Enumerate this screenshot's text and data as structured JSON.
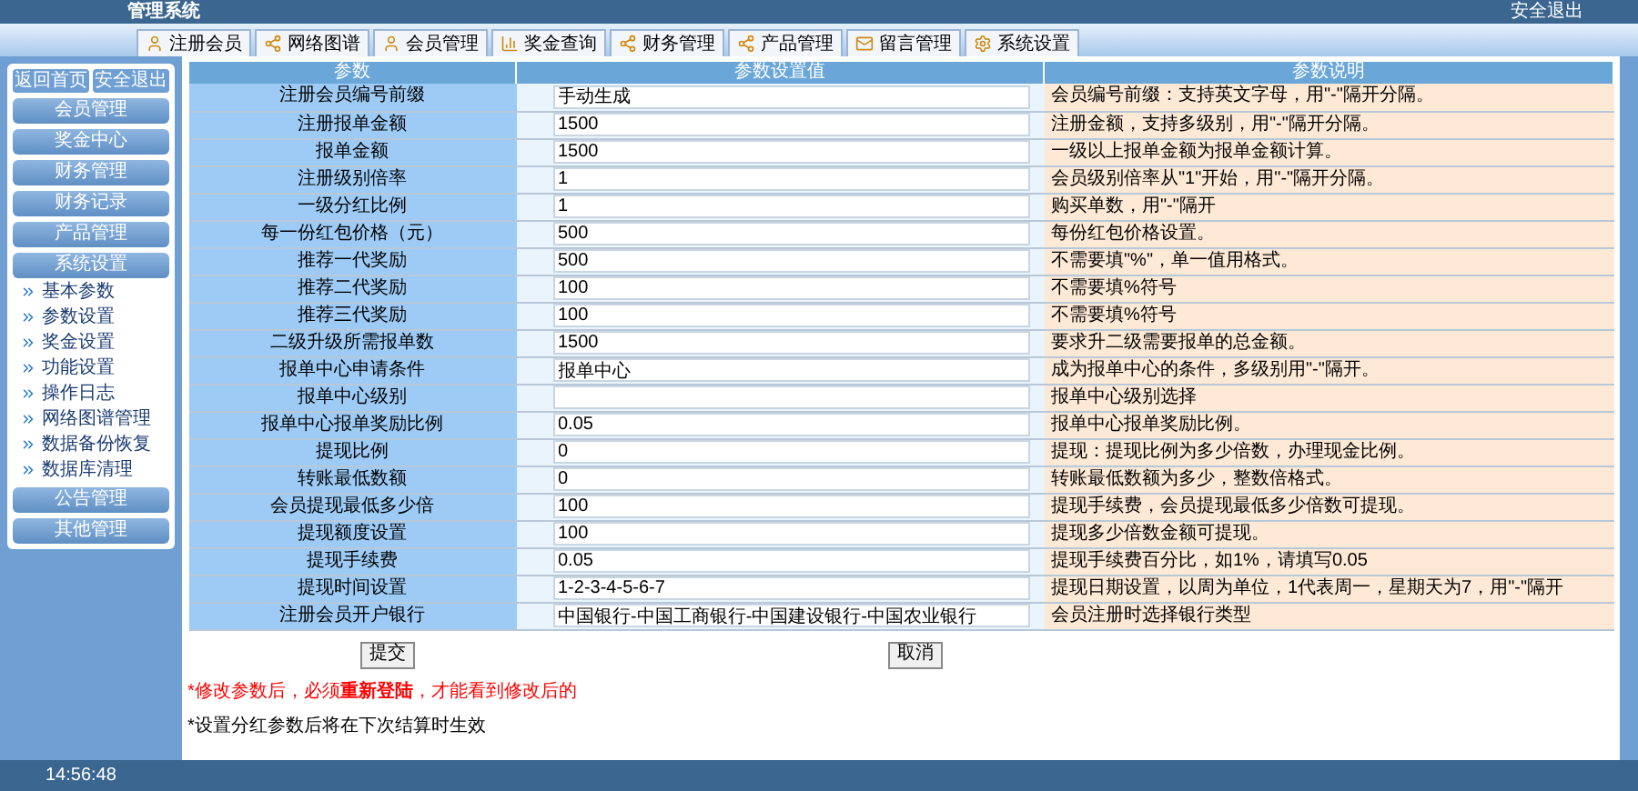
{
  "header": {
    "title": "管理系统",
    "logout": "安全退出"
  },
  "tabs": [
    {
      "label": "注册会员"
    },
    {
      "label": "网络图谱"
    },
    {
      "label": "会员管理"
    },
    {
      "label": "奖金查询"
    },
    {
      "label": "财务管理"
    },
    {
      "label": "产品管理"
    },
    {
      "label": "留言管理"
    },
    {
      "label": "系统设置"
    }
  ],
  "sidebar": {
    "top_buttons": [
      "返回首页",
      "安全退出"
    ],
    "menus": [
      {
        "label": "会员管理"
      },
      {
        "label": "奖金中心"
      },
      {
        "label": "财务管理"
      },
      {
        "label": "财务记录"
      },
      {
        "label": "产品管理"
      },
      {
        "label": "系统设置",
        "children": [
          "基本参数",
          "参数设置",
          "奖金设置",
          "功能设置",
          "操作日志",
          "网络图谱管理",
          "数据备份恢复",
          "数据库清理"
        ]
      },
      {
        "label": "公告管理"
      },
      {
        "label": "其他管理"
      }
    ]
  },
  "table": {
    "columns": [
      "参数",
      "参数设置值",
      "参数说明"
    ],
    "rows": [
      {
        "label": "注册会员编号前缀",
        "value": "手动生成",
        "note": "会员编号前缀：支持英文字母，用\"-\"隔开分隔。"
      },
      {
        "label": "注册报单金额",
        "value": "1500",
        "note": "注册金额，支持多级别，用\"-\"隔开分隔。"
      },
      {
        "label": "报单金额",
        "value": "1500",
        "note": "一级以上报单金额为报单金额计算。"
      },
      {
        "label": "注册级别倍率",
        "value": "1",
        "note": "会员级别倍率从\"1\"开始，用\"-\"隔开分隔。"
      },
      {
        "label": "一级分红比例",
        "value": "1",
        "note": "购买单数，用\"-\"隔开"
      },
      {
        "label": "每一份红包价格（元）",
        "value": "500",
        "note": "每份红包价格设置。"
      },
      {
        "label": "推荐一代奖励",
        "value": "500",
        "note": "不需要填\"%\"，单一值用格式。"
      },
      {
        "label": "推荐二代奖励",
        "value": "100",
        "note": "不需要填%符号"
      },
      {
        "label": "推荐三代奖励",
        "value": "100",
        "note": "不需要填%符号"
      },
      {
        "label": "二级升级所需报单数",
        "value": "1500",
        "note": "要求升二级需要报单的总金额。"
      },
      {
        "label": "报单中心申请条件",
        "value": "报单中心",
        "note": "成为报单中心的条件，多级别用\"-\"隔开。"
      },
      {
        "label": "报单中心级别",
        "note": "报单中心级别选择"
      },
      {
        "label": "报单中心报单奖励比例",
        "value": "0.05",
        "note": "报单中心报单奖励比例。"
      },
      {
        "label": "提现比例",
        "value": "0",
        "note": "提现：提现比例为多少倍数，办理现金比例。"
      },
      {
        "label": "转账最低数额",
        "value": "0",
        "note": "转账最低数额为多少，整数倍格式。"
      },
      {
        "label": "会员提现最低多少倍",
        "value": "100",
        "note": "提现手续费，会员提现最低多少倍数可提现。"
      },
      {
        "label": "提现额度设置",
        "value": "100",
        "note": "提现多少倍数金额可提现。"
      },
      {
        "label": "提现手续费",
        "value": "0.05",
        "note": "提现手续费百分比，如1%，请填写0.05"
      },
      {
        "label": "提现时间设置",
        "value": "1-2-3-4-5-6-7",
        "note": "提现日期设置，以周为单位，1代表周一，星期天为7，用\"-\"隔开"
      },
      {
        "label": "注册会员开户银行",
        "value": "中国银行-中国工商银行-中国建设银行-中国农业银行",
        "note": "会员注册时选择银行类型"
      }
    ]
  },
  "buttons": [
    "提交",
    "取消"
  ],
  "notes": [
    {
      "kind": "warning",
      "text": "*修改参数后，必须**重新登陆**，才能看到修改后的"
    },
    {
      "kind": "info",
      "text": "*设置分红参数后将在下次结算时生效"
    }
  ],
  "status_bar": {
    "time": "14:56:48"
  }
}
